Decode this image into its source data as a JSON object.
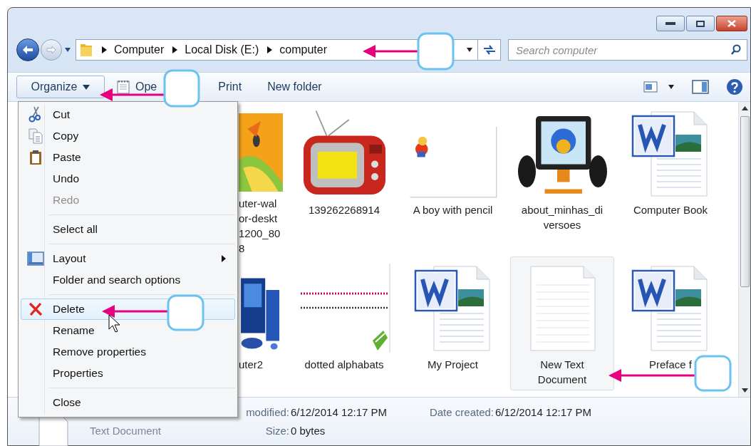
{
  "address_bar": {
    "crumbs": [
      "Computer",
      "Local Disk (E:)",
      "computer"
    ]
  },
  "search": {
    "placeholder": "Search computer"
  },
  "toolbar": {
    "items": [
      {
        "label": "Organize",
        "kind": "dropdown",
        "selected": true
      },
      {
        "label": "Ope",
        "kind": "open",
        "selected": false
      },
      {
        "label": "Print",
        "kind": "plain",
        "selected": false
      },
      {
        "label": "New folder",
        "kind": "plain",
        "selected": false
      }
    ]
  },
  "organize_menu": {
    "groups": [
      {
        "items": [
          {
            "label": "Cut",
            "kind": "cut",
            "disabled": false,
            "selected": false
          },
          {
            "label": "Copy",
            "kind": "copy",
            "disabled": false,
            "selected": false
          },
          {
            "label": "Paste",
            "kind": "paste",
            "disabled": false,
            "selected": false
          },
          {
            "label": "Undo",
            "kind": "plain",
            "disabled": false,
            "selected": false
          },
          {
            "label": "Redo",
            "kind": "plain",
            "disabled": true,
            "selected": false
          }
        ]
      },
      {
        "items": [
          {
            "label": "Select all",
            "kind": "plain",
            "disabled": false,
            "selected": false
          }
        ]
      },
      {
        "items": [
          {
            "label": "Layout",
            "kind": "layout",
            "submenu": true,
            "disabled": false,
            "selected": false
          },
          {
            "label": "Folder and search options",
            "kind": "plain",
            "disabled": false,
            "selected": false
          }
        ]
      },
      {
        "items": [
          {
            "label": "Delete",
            "kind": "delete",
            "disabled": false,
            "selected": true
          },
          {
            "label": "Rename",
            "kind": "plain",
            "disabled": false,
            "selected": false
          },
          {
            "label": "Remove properties",
            "kind": "plain",
            "disabled": false,
            "selected": false
          },
          {
            "label": "Properties",
            "kind": "plain",
            "disabled": false,
            "selected": false
          }
        ]
      },
      {
        "items": [
          {
            "label": "Close",
            "kind": "plain",
            "disabled": false,
            "selected": false
          }
        ]
      }
    ]
  },
  "files": {
    "rows": [
      [
        {
          "label": "uter-wal\nor-deskt\n1200_80\n8",
          "kind": "picture",
          "selected": false
        },
        {
          "label": "139262268914",
          "kind": "picture",
          "selected": false
        },
        {
          "label": "A boy with pencil",
          "kind": "picture",
          "selected": false
        },
        {
          "label": "about_minhas_di\nversoes",
          "kind": "picture",
          "selected": false
        },
        {
          "label": "Computer Book",
          "kind": "word",
          "selected": false
        }
      ],
      [
        {
          "label": "uter2",
          "kind": "picture",
          "selected": false
        },
        {
          "label": "dotted alphabats",
          "kind": "picture",
          "selected": false
        },
        {
          "label": "My Project",
          "kind": "word",
          "selected": false
        },
        {
          "label": "New Text\nDocument",
          "kind": "text",
          "selected": true
        },
        {
          "label": "Preface f",
          "kind": "word",
          "selected": false
        }
      ]
    ]
  },
  "details": {
    "type": "Text Document",
    "fields": [
      {
        "label": "modified:",
        "value": "6/12/2014 12:17 PM"
      },
      {
        "label": "Date created:",
        "value": "6/12/2014 12:17 PM"
      },
      {
        "label": "Size:",
        "value": "0 bytes"
      }
    ]
  }
}
